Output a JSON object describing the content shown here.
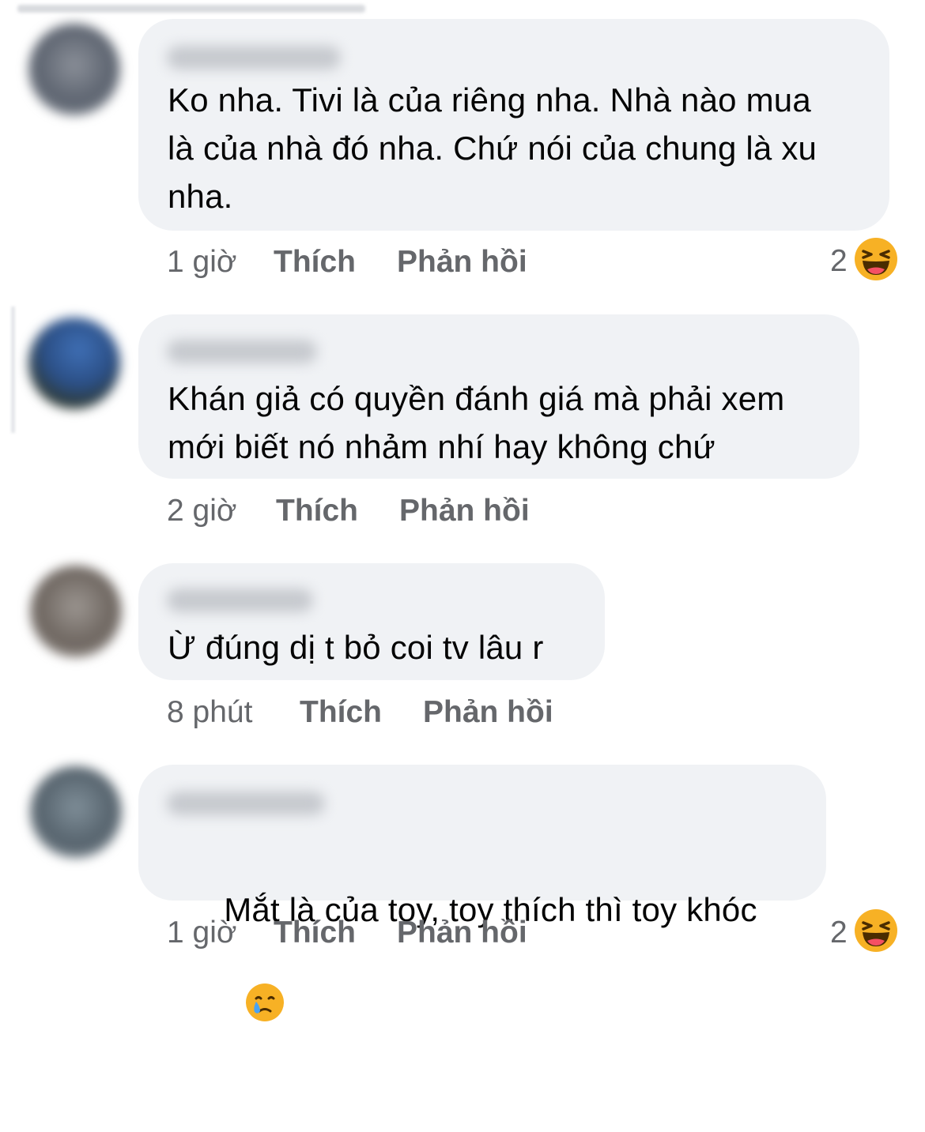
{
  "comments": [
    {
      "text": "Ko nha. Tivi là của riêng nha. Nhà nào mua\nlà của nhà đó nha. Chứ nói của chung là xu\nnha.",
      "time": "1 giờ",
      "like_label": "Thích",
      "reply_label": "Phản hồi",
      "reaction_count": "2",
      "reaction_icon": "haha-icon"
    },
    {
      "text": "Khán giả có quyền đánh giá mà phải xem\nmới biết nó nhảm nhí hay không chứ",
      "time": "2 giờ",
      "like_label": "Thích",
      "reply_label": "Phản hồi"
    },
    {
      "text": "Ừ đúng dị t bỏ coi tv lâu r",
      "time": "8 phút",
      "like_label": "Thích",
      "reply_label": "Phản hồi"
    },
    {
      "text": "Mắt là của toy, toy thích thì toy khóc",
      "inline_emoji": "crying-face-icon",
      "time": "1 giờ",
      "like_label": "Thích",
      "reply_label": "Phản hồi",
      "reaction_count": "2",
      "reaction_icon": "haha-icon"
    }
  ],
  "colors": {
    "bubble": "#f0f2f5",
    "text": "#050505",
    "meta": "#65676b",
    "emoji_yellow": "#f7b125"
  }
}
